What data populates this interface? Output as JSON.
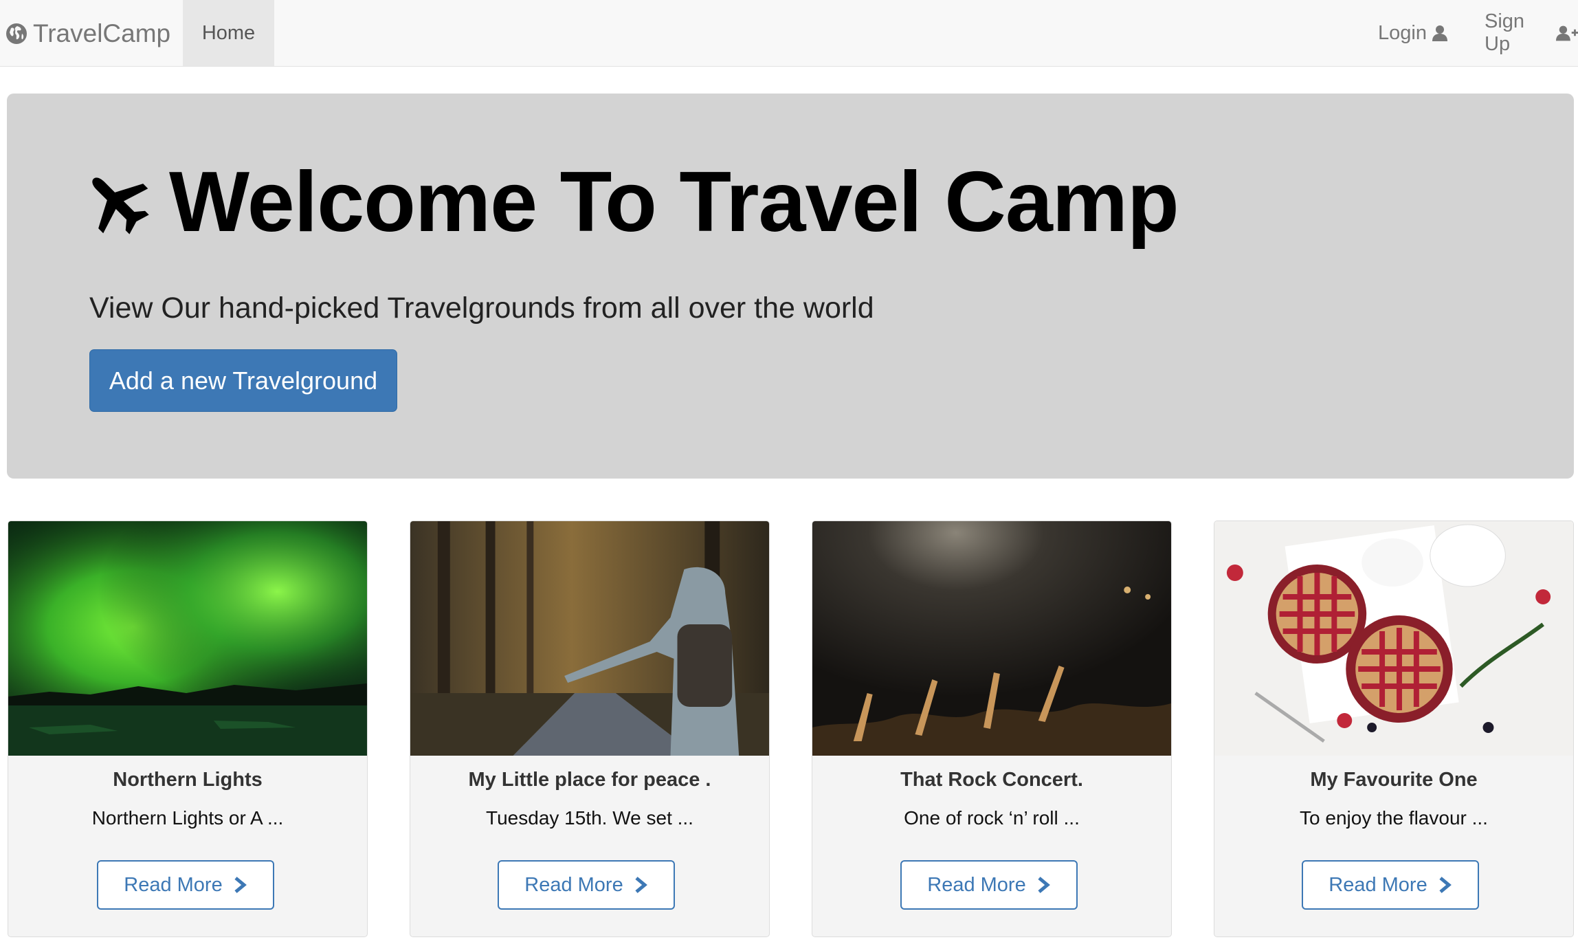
{
  "navbar": {
    "brand": "TravelCamp",
    "brand_icon": "globe-icon",
    "home_label": "Home",
    "login_label": "Login",
    "login_icon": "user-icon",
    "signup_label": "Sign Up",
    "signup_icon": "user-plus-icon"
  },
  "hero": {
    "icon": "plane-icon",
    "title": "Welcome To Travel Camp",
    "subtitle": "View Our hand-picked Travelgrounds from all over the world",
    "button_label": "Add a new Travelground"
  },
  "cards": [
    {
      "title": "Northern Lights",
      "description": "Northern Lights or A ...",
      "button_label": "Read More"
    },
    {
      "title": "My Little place for peace .",
      "description": "Tuesday 15th. We set ...",
      "button_label": "Read More"
    },
    {
      "title": "That Rock Concert.",
      "description": "One of rock ‘n’ roll ...",
      "button_label": "Read More"
    },
    {
      "title": "My Favourite One",
      "description": "To enjoy the flavour ...",
      "button_label": "Read More"
    }
  ],
  "colors": {
    "primary": "#3d78b5",
    "jumbotron_bg": "#d3d3d3",
    "navbar_bg": "#f8f8f8"
  }
}
